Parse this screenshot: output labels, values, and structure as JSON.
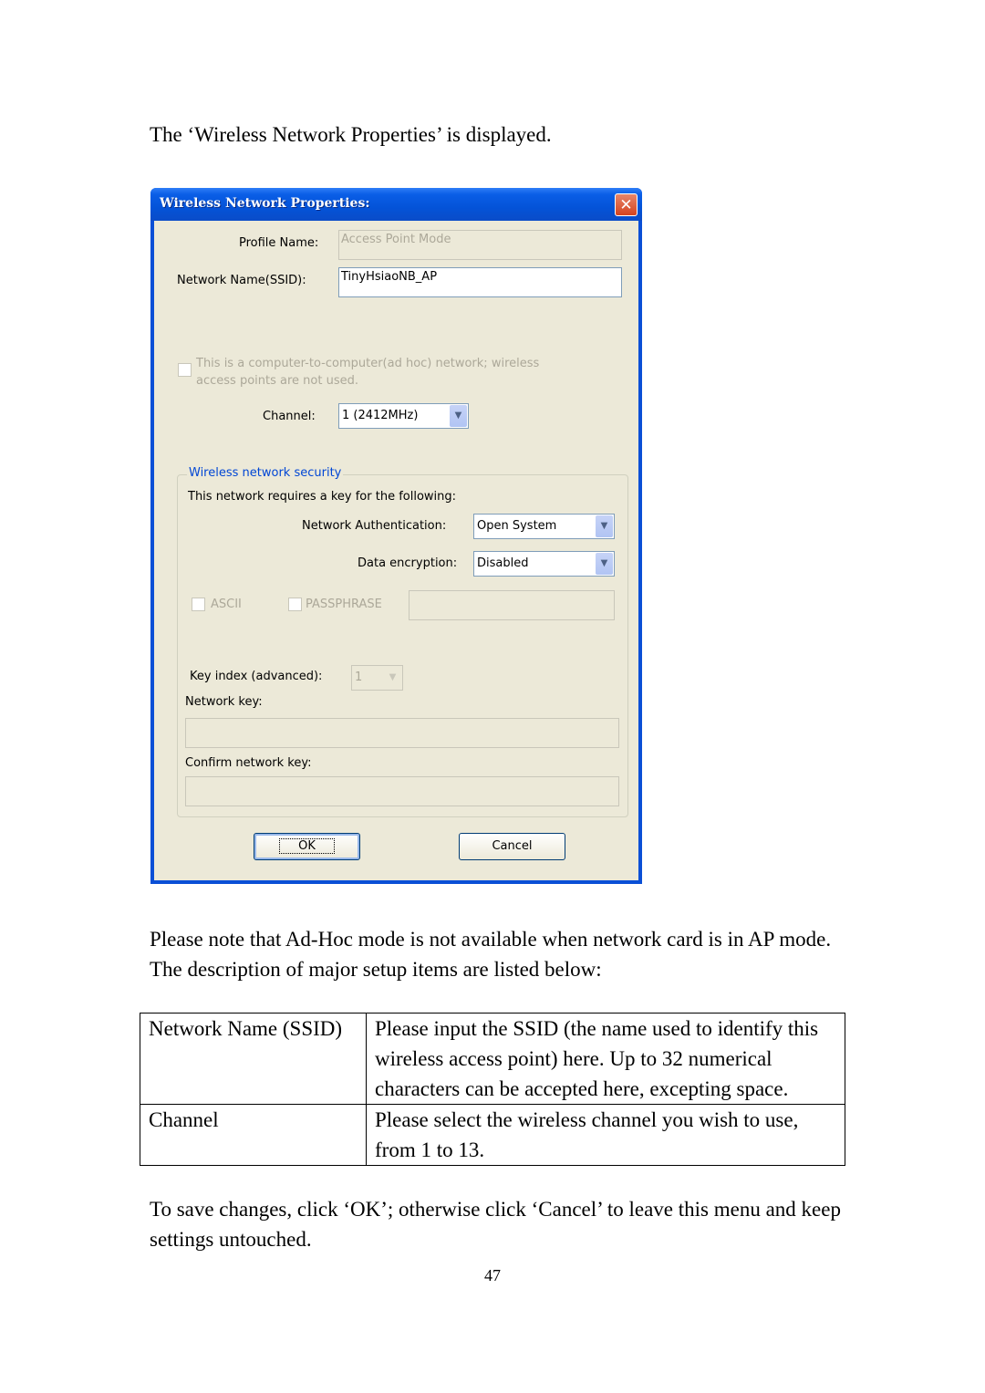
{
  "intro_text": "The ‘Wireless Network Properties’ is displayed.",
  "dialog": {
    "title": "Wireless Network Properties:",
    "close_icon": "close-icon",
    "profile_name_label": "Profile Name:",
    "profile_name_value": "Access Point Mode",
    "ssid_label": "Network Name(SSID):",
    "ssid_value": "TinyHsiaoNB_AP",
    "adhoc_checkbox_label_line1": "This is a computer-to-computer(ad hoc) network; wireless",
    "adhoc_checkbox_label_line2": "access points are not used.",
    "adhoc_checked": false,
    "channel_label": "Channel:",
    "channel_value": "1  (2412MHz)",
    "security": {
      "group_title": "Wireless network security",
      "requires_key_text": "This network requires a key for the following:",
      "auth_label": "Network Authentication:",
      "auth_value": "Open System",
      "encryption_label": "Data encryption:",
      "encryption_value": "Disabled",
      "ascii_label": "ASCII",
      "ascii_checked": false,
      "passphrase_label": "PASSPHRASE",
      "passphrase_checked": false,
      "passphrase_value": "",
      "key_index_label": "Key index (advanced):",
      "key_index_value": "1",
      "network_key_label": "Network key:",
      "network_key_value": "",
      "confirm_key_label": "Confirm network key:",
      "confirm_key_value": ""
    },
    "ok_label": "OK",
    "cancel_label": "Cancel"
  },
  "note_text": "Please note that Ad-Hoc mode is not available when network card is in AP mode. The description of major setup items are listed below:",
  "table": {
    "rows": [
      {
        "item": "Network Name (SSID)",
        "description": "Please input the SSID (the name used to identify this wireless access point) here. Up to 32 numerical characters can be accepted here, excepting space."
      },
      {
        "item": "Channel",
        "description": "Please select the wireless channel you wish to use, from 1 to 13."
      }
    ]
  },
  "outro_text": "To save changes, click ‘OK’; otherwise click ‘Cancel’ to leave this menu and keep settings untouched.",
  "page_number": "47"
}
